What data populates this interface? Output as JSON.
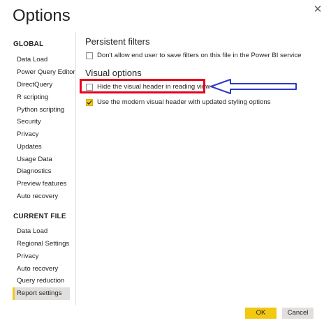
{
  "dialog": {
    "title": "Options",
    "close_glyph": "✕",
    "close_icon": "close-icon"
  },
  "sidebar": {
    "global_heading": "GLOBAL",
    "global_items": [
      {
        "label": "Data Load"
      },
      {
        "label": "Power Query Editor"
      },
      {
        "label": "DirectQuery"
      },
      {
        "label": "R scripting"
      },
      {
        "label": "Python scripting"
      },
      {
        "label": "Security"
      },
      {
        "label": "Privacy"
      },
      {
        "label": "Updates"
      },
      {
        "label": "Usage Data"
      },
      {
        "label": "Diagnostics"
      },
      {
        "label": "Preview features"
      },
      {
        "label": "Auto recovery"
      }
    ],
    "current_heading": "CURRENT FILE",
    "current_items": [
      {
        "label": "Data Load"
      },
      {
        "label": "Regional Settings"
      },
      {
        "label": "Privacy"
      },
      {
        "label": "Auto recovery"
      },
      {
        "label": "Query reduction"
      },
      {
        "label": "Report settings",
        "selected": true
      }
    ]
  },
  "content": {
    "persistent_filters": {
      "heading": "Persistent filters",
      "option_label": "Don't allow end user to save filters on this file in the Power BI service",
      "checked": false
    },
    "visual_options": {
      "heading": "Visual options",
      "options": [
        {
          "label": "Hide the visual header in reading view",
          "checked": false
        },
        {
          "label": "Use the modern visual header with updated styling options",
          "checked": true
        }
      ]
    }
  },
  "annotation": {
    "highlight_color": "#e8001c",
    "arrow_color": "#2b3bc6",
    "arrow_icon": "left-arrow-icon"
  },
  "footer": {
    "ok_label": "OK",
    "cancel_label": "Cancel"
  },
  "colors": {
    "accent": "#f2c811",
    "selected_bg": "#e1dfdd",
    "text": "#252423"
  }
}
